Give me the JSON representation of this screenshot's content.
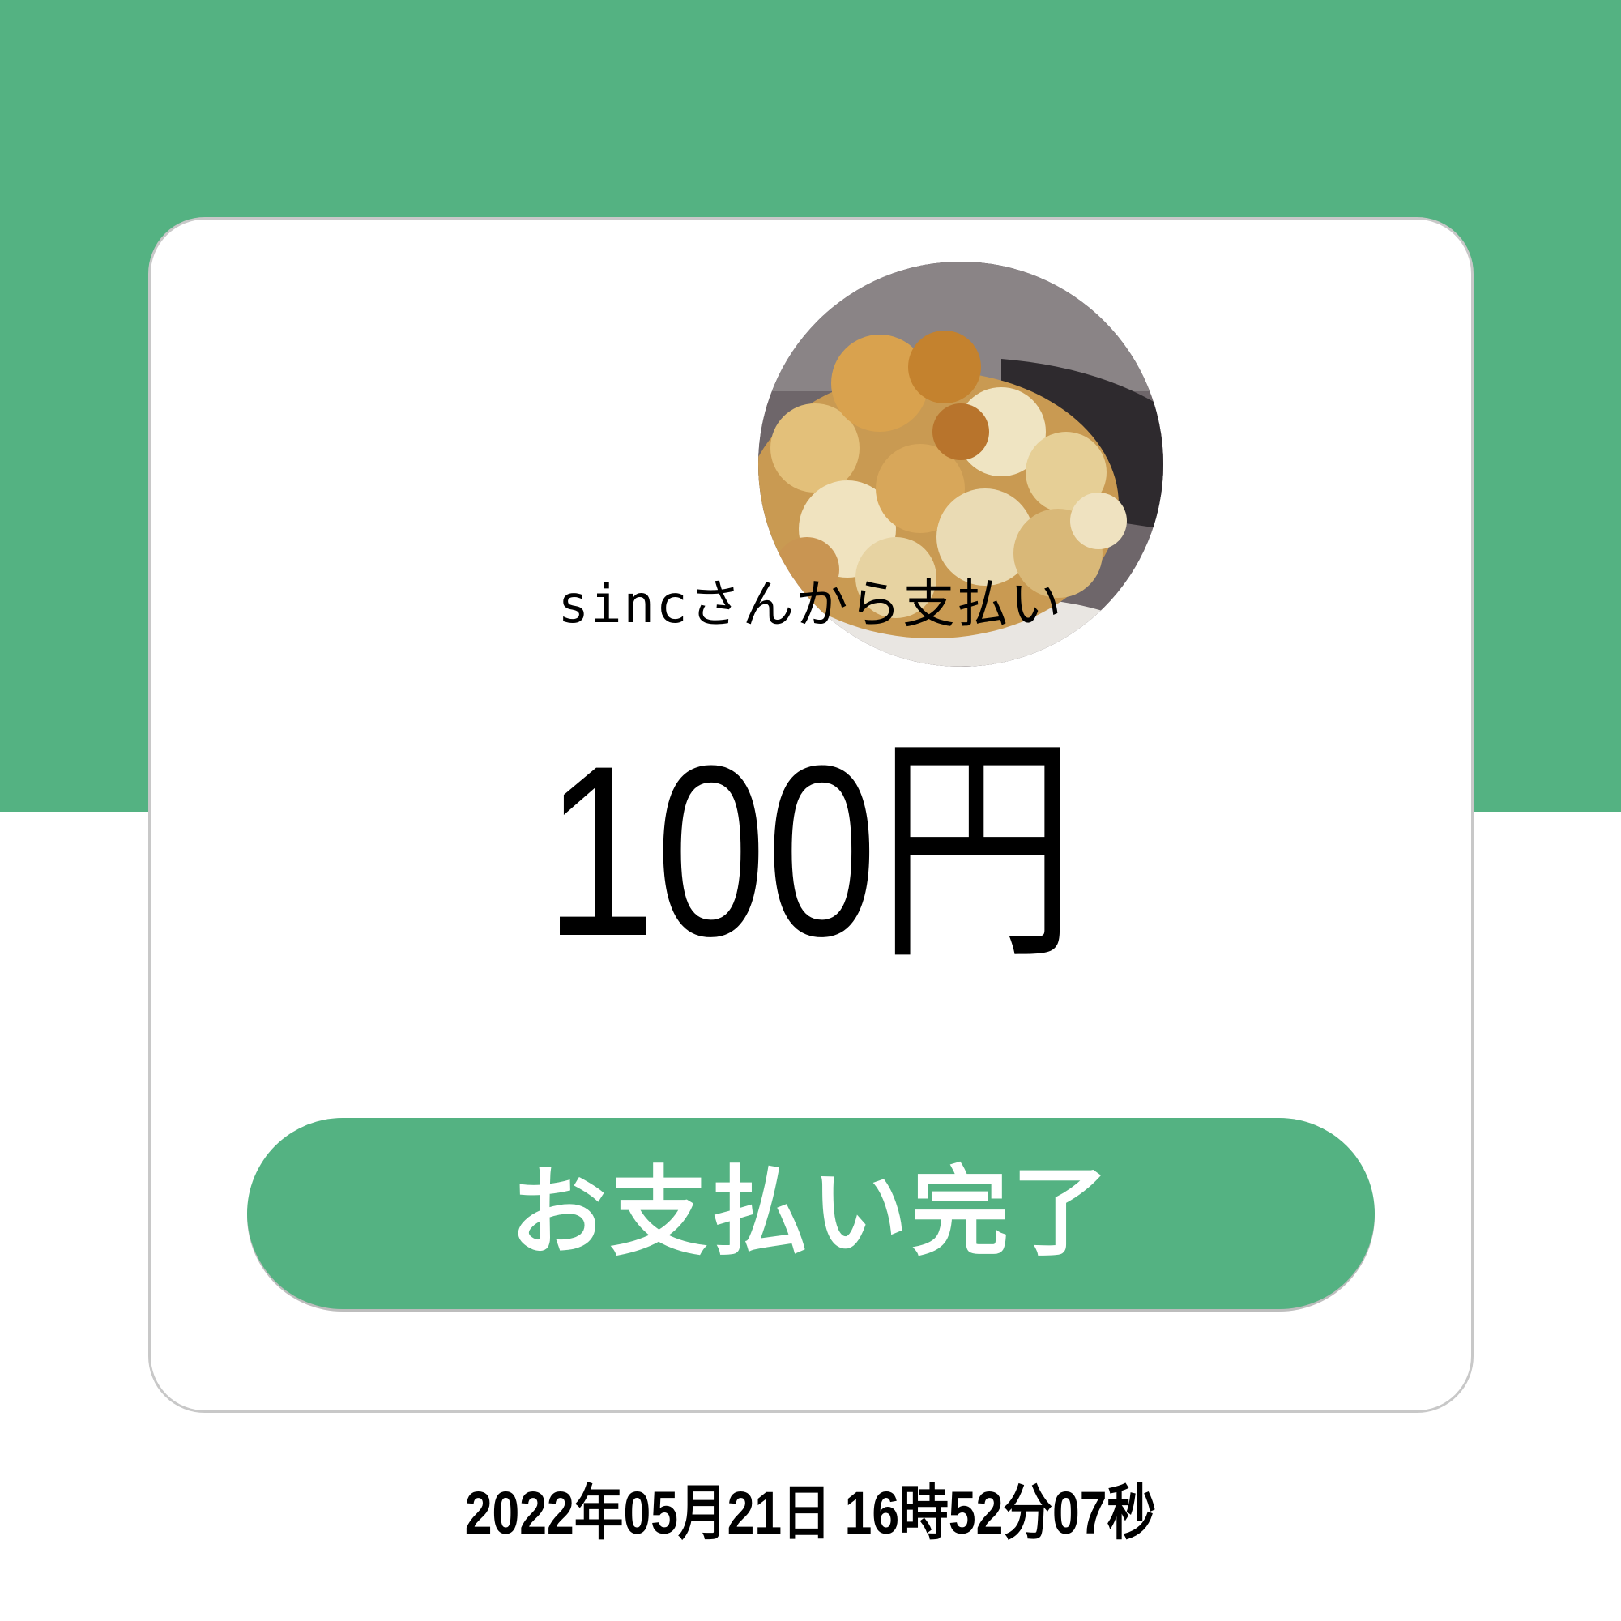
{
  "payment": {
    "payer_text": "sincさんから支払い",
    "amount": "100円",
    "status_label": "お支払い完了",
    "timestamp": "2022年05月21日  16時52分07秒"
  },
  "avatar": {
    "icon": "popcorn-photo"
  },
  "colors": {
    "accent": "#54b282",
    "card": "#ffffff",
    "text": "#000000"
  }
}
